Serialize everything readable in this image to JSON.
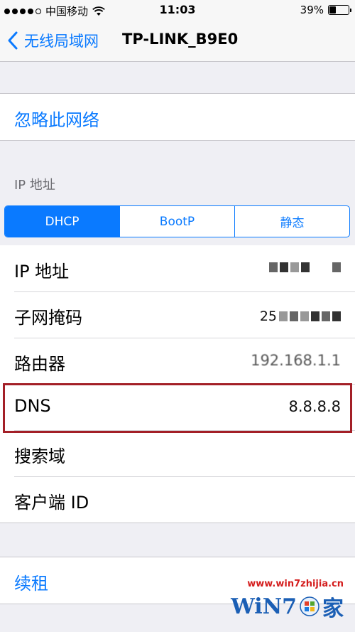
{
  "status_bar": {
    "carrier": "中国移动",
    "time": "11:03",
    "battery_percent": "39%",
    "battery_level": 0.39,
    "signal_bars_filled": 4,
    "signal_bars_total": 5
  },
  "nav": {
    "back_label": "无线局域网",
    "title": "TP-LINK_B9E0"
  },
  "forget_network": "忽略此网络",
  "ip_section_header": "IP 地址",
  "ip_mode_tabs": [
    "DHCP",
    "BootP",
    "静态"
  ],
  "ip_mode_selected": "DHCP",
  "fields": [
    {
      "label": "IP 地址",
      "value": ""
    },
    {
      "label": "子网掩码",
      "value": "255.???"
    },
    {
      "label": "路由器",
      "value": "192.168.1.1"
    },
    {
      "label": "DNS",
      "value": "8.8.8.8"
    },
    {
      "label": "搜索域",
      "value": ""
    },
    {
      "label": "客户端 ID",
      "value": ""
    }
  ],
  "renew_lease": "续租",
  "watermark": {
    "url": "www.win7zhijia.cn",
    "logo_text": "WiN7",
    "logo_cn": "家"
  },
  "colors": {
    "accent": "#0a7aff",
    "highlight": "#a31f27",
    "background": "#efeff4"
  }
}
